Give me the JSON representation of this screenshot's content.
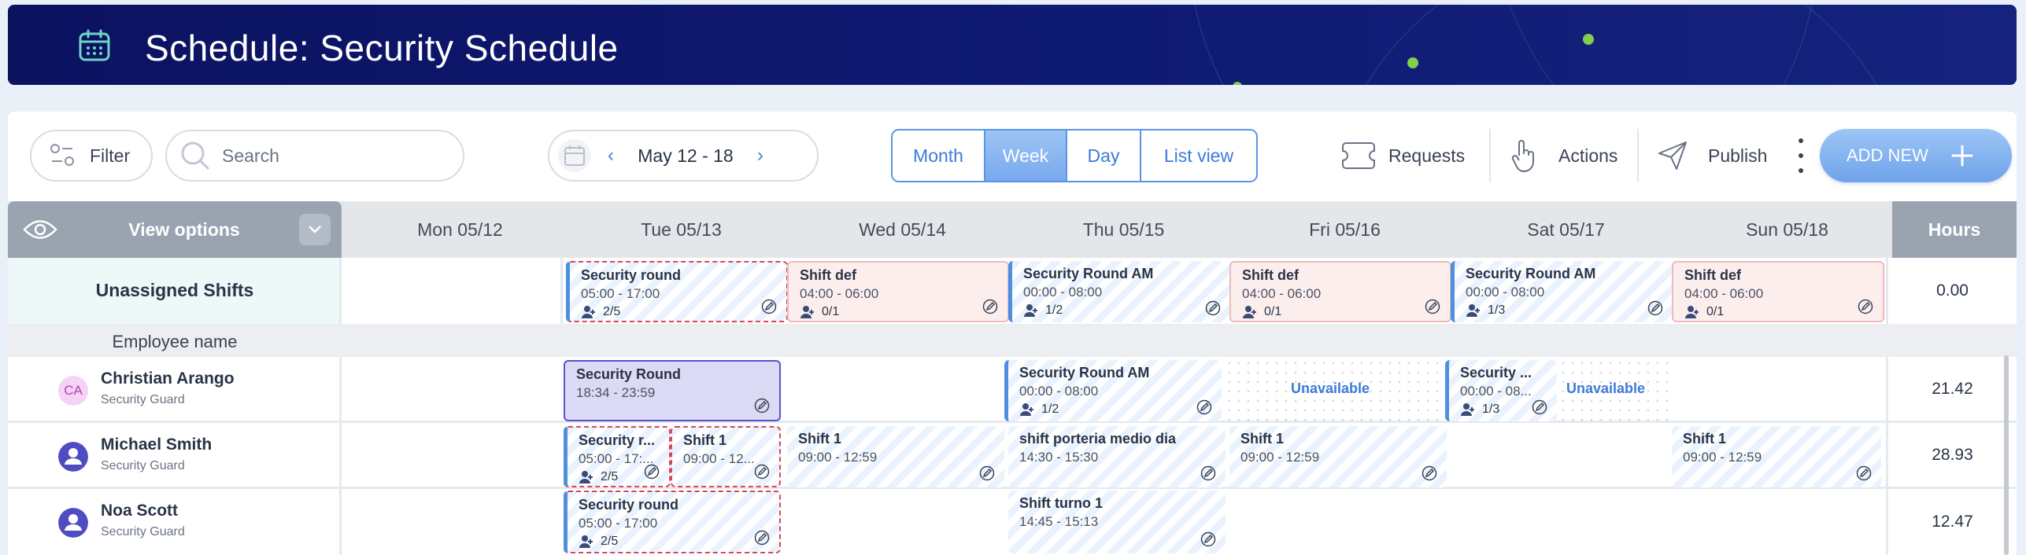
{
  "header": {
    "title": "Schedule: Security Schedule",
    "icon": "calendar-icon"
  },
  "toolbar": {
    "filter_label": "Filter",
    "search_placeholder": "Search",
    "date_range": "May 12 - 18",
    "views": [
      "Month",
      "Week",
      "Day",
      "List view"
    ],
    "active_view": "Week",
    "requests_label": "Requests",
    "actions_label": "Actions",
    "publish_label": "Publish",
    "add_new_label": "ADD NEW"
  },
  "grid": {
    "view_options_label": "View options",
    "days": [
      "Mon 05/12",
      "Tue 05/13",
      "Wed 05/14",
      "Thu 05/15",
      "Fri 05/16",
      "Sat 05/17",
      "Sun 05/18"
    ],
    "hours_label": "Hours",
    "unassigned_label": "Unassigned Shifts",
    "unassigned_hours": "0.00",
    "employee_name_label": "Employee name",
    "unavailable_label": "Unavailable"
  },
  "unassigned_shifts": [
    {
      "title": "Security round",
      "time": "05:00 - 17:00",
      "count": "2/5"
    },
    {
      "title": "Shift def",
      "time": "04:00 - 06:00",
      "count": "0/1"
    },
    {
      "title": "Security Round AM",
      "time": "00:00 - 08:00",
      "count": "1/2"
    },
    {
      "title": "Shift def",
      "time": "04:00 - 06:00",
      "count": "0/1"
    },
    {
      "title": "Security Round AM",
      "time": "00:00 - 08:00",
      "count": "1/3"
    },
    {
      "title": "Shift def",
      "time": "04:00 - 06:00",
      "count": "0/1"
    }
  ],
  "employees": [
    {
      "initials": "CA",
      "name": "Christian Arango",
      "role": "Security Guard",
      "hours": "21.42",
      "shifts": [
        {
          "title": "Security Round",
          "time": "18:34 - 23:59"
        },
        {
          "title": "Security Round AM",
          "time": "00:00 - 08:00",
          "count": "1/2"
        },
        {
          "title": "Security ...",
          "time": "00:00 - 08...",
          "count": "1/3"
        }
      ]
    },
    {
      "name": "Michael Smith",
      "role": "Security Guard",
      "hours": "28.93",
      "shifts": [
        {
          "title": "Security r...",
          "time": "05:00 - 17:...",
          "count": "2/5"
        },
        {
          "title": "Shift 1",
          "time": "09:00 - 12..."
        },
        {
          "title": "Shift 1",
          "time": "09:00 - 12:59"
        },
        {
          "title": "shift porteria medio dia",
          "time": "14:30 - 15:30"
        },
        {
          "title": "Shift 1",
          "time": "09:00 - 12:59"
        },
        {
          "title": "Shift 1",
          "time": "09:00 - 12:59"
        }
      ]
    },
    {
      "name": "Noa Scott",
      "role": "Security Guard",
      "hours": "12.47",
      "shifts": [
        {
          "title": "Security round",
          "time": "05:00 - 17:00",
          "count": "2/5"
        },
        {
          "title": "Shift turno 1",
          "time": "14:45 - 15:13"
        }
      ]
    }
  ],
  "colors": {
    "banner": "#0f1a72",
    "accent": "#3d7bd9",
    "avatar_ca_bg": "#f6d2f6",
    "avatar_ca_text": "#b048b8",
    "avatar_default": "#4f4cc1",
    "alert_dash": "#d8465b"
  }
}
